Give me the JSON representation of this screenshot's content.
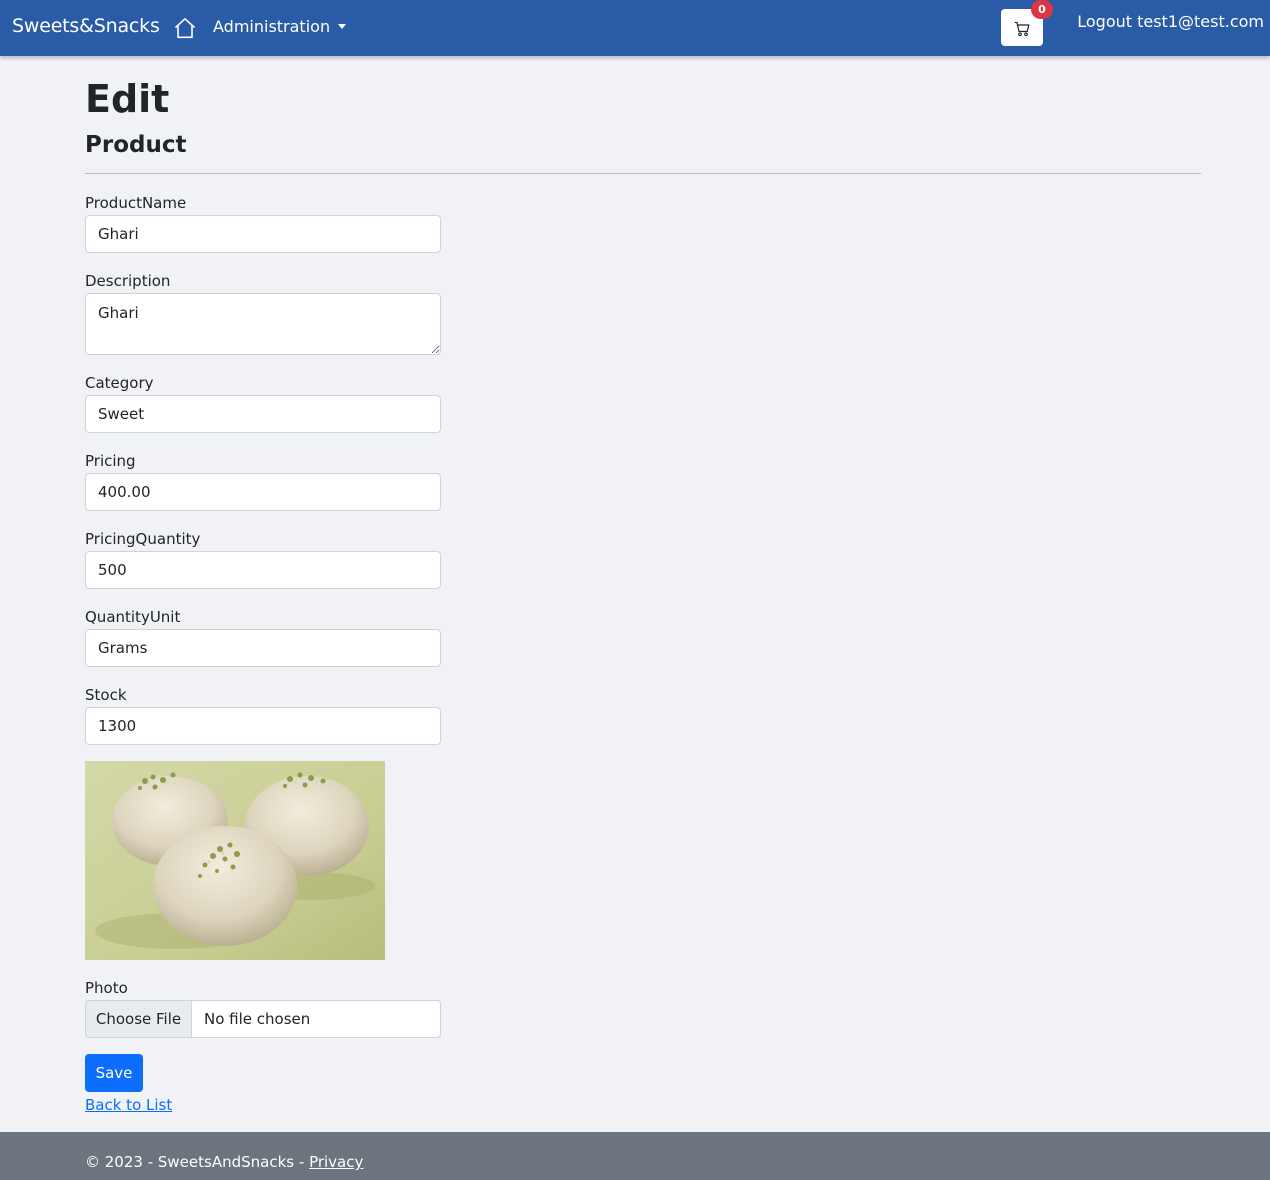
{
  "navbar": {
    "brand": "Sweets&Snacks",
    "admin_menu": "Administration",
    "cart_count": "0",
    "logout": "Logout test1@test.com"
  },
  "page": {
    "title": "Edit",
    "subtitle": "Product"
  },
  "form": {
    "product_name": {
      "label": "ProductName",
      "value": "Ghari"
    },
    "description": {
      "label": "Description",
      "value": "Ghari"
    },
    "category": {
      "label": "Category",
      "value": "Sweet"
    },
    "pricing": {
      "label": "Pricing",
      "value": "400.00"
    },
    "pricing_quantity": {
      "label": "PricingQuantity",
      "value": "500"
    },
    "quantity_unit": {
      "label": "QuantityUnit",
      "value": "Grams"
    },
    "stock": {
      "label": "Stock",
      "value": "1300"
    },
    "photo": {
      "label": "Photo",
      "button": "Choose File",
      "status": "No file chosen"
    },
    "save_label": "Save",
    "back_link": "Back to List"
  },
  "footer": {
    "copyright": "© 2023 - SweetsAndSnacks -",
    "privacy": "Privacy"
  },
  "icons": {
    "home": "home-icon",
    "cart": "cart-icon",
    "dropdown": "caret-down-icon"
  },
  "colors": {
    "navbar": "#2a5ba6",
    "primary": "#0d6efd",
    "badge": "#dc3545",
    "footer": "#6c757d",
    "background": "#f1f2f6"
  }
}
